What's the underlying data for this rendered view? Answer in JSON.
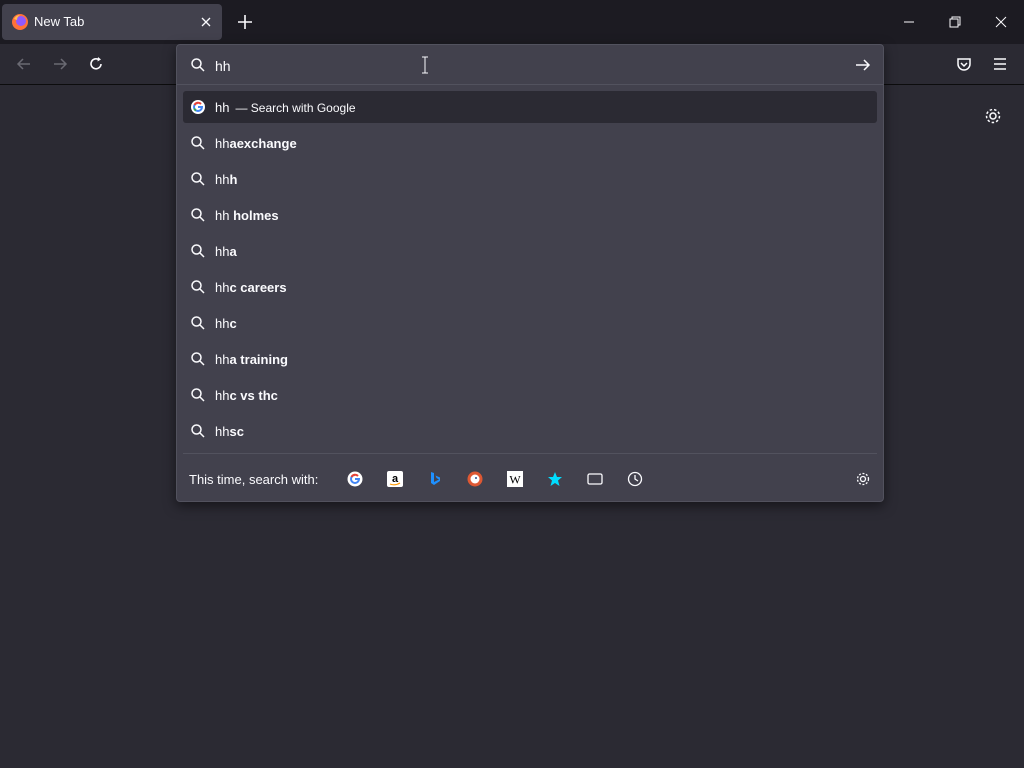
{
  "tabstrip": {
    "tab": {
      "title": "New Tab",
      "favicon": "firefox-icon"
    },
    "new_tab_icon": "plus-icon",
    "window_controls": [
      "minimize-icon",
      "restore-icon",
      "close-icon"
    ]
  },
  "navbar": {
    "buttons": [
      "back-icon",
      "forward-icon",
      "reload-icon"
    ],
    "right_icons": [
      "pocket-icon",
      "menu-icon"
    ]
  },
  "urlbar": {
    "value": "hh",
    "colors": {
      "popup_bg": "#42414d",
      "selected_bg": "#2b2a33",
      "accent": "#00ddff"
    }
  },
  "results": {
    "first": {
      "typed": "hh",
      "suffix": "— Search with Google",
      "icon": "google-icon"
    },
    "suggestions": [
      {
        "typed": "hh",
        "bold": "aexchange"
      },
      {
        "typed": "hh",
        "bold": "h"
      },
      {
        "typed": "hh ",
        "bold": "holmes"
      },
      {
        "typed": "hh",
        "bold": "a"
      },
      {
        "typed": "hh",
        "bold": "c careers"
      },
      {
        "typed": "hh",
        "bold": "c"
      },
      {
        "typed": "hh",
        "bold": "a training"
      },
      {
        "typed": "hh",
        "bold": "c vs thc"
      },
      {
        "typed": "hh",
        "bold": "sc"
      }
    ]
  },
  "oneoff": {
    "label": "This time, search with:",
    "engines": [
      "google-icon",
      "amazon-icon",
      "bing-icon",
      "duckduckgo-icon",
      "wikipedia-icon",
      "bookmarks-icon",
      "tabs-icon",
      "history-icon"
    ]
  }
}
